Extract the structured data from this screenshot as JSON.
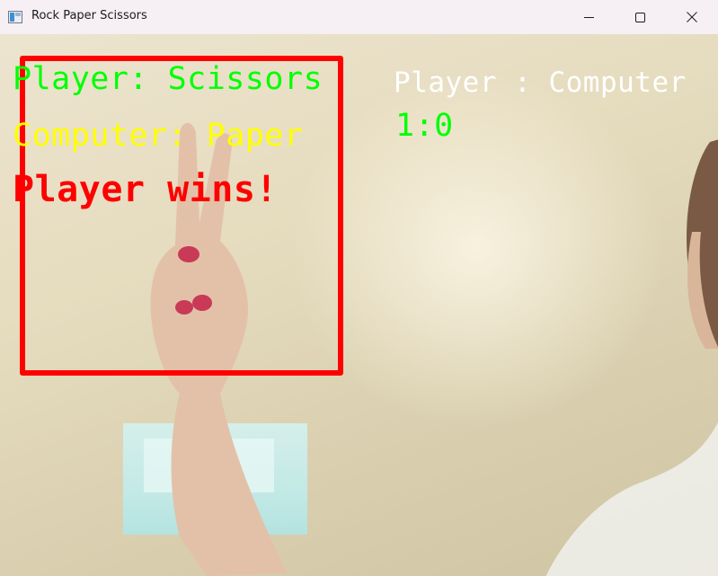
{
  "window": {
    "title": "Rock Paper Scissors",
    "icons": {
      "app": "app-window-icon",
      "minimize": "minimize-icon",
      "maximize": "maximize-icon",
      "close": "close-icon"
    }
  },
  "overlay": {
    "player_choice": "Player: Scissors",
    "computer_choice": "Computer: Paper",
    "result": "Player wins!",
    "score_header": "Player : Computer",
    "score_value": "1:0"
  },
  "colors": {
    "player_text": "#00ff00",
    "computer_text": "#ffff00",
    "result_text": "#ff0000",
    "score_header_text": "#ffffff",
    "score_value_text": "#00ff00",
    "roi_box": "#ff0000"
  }
}
